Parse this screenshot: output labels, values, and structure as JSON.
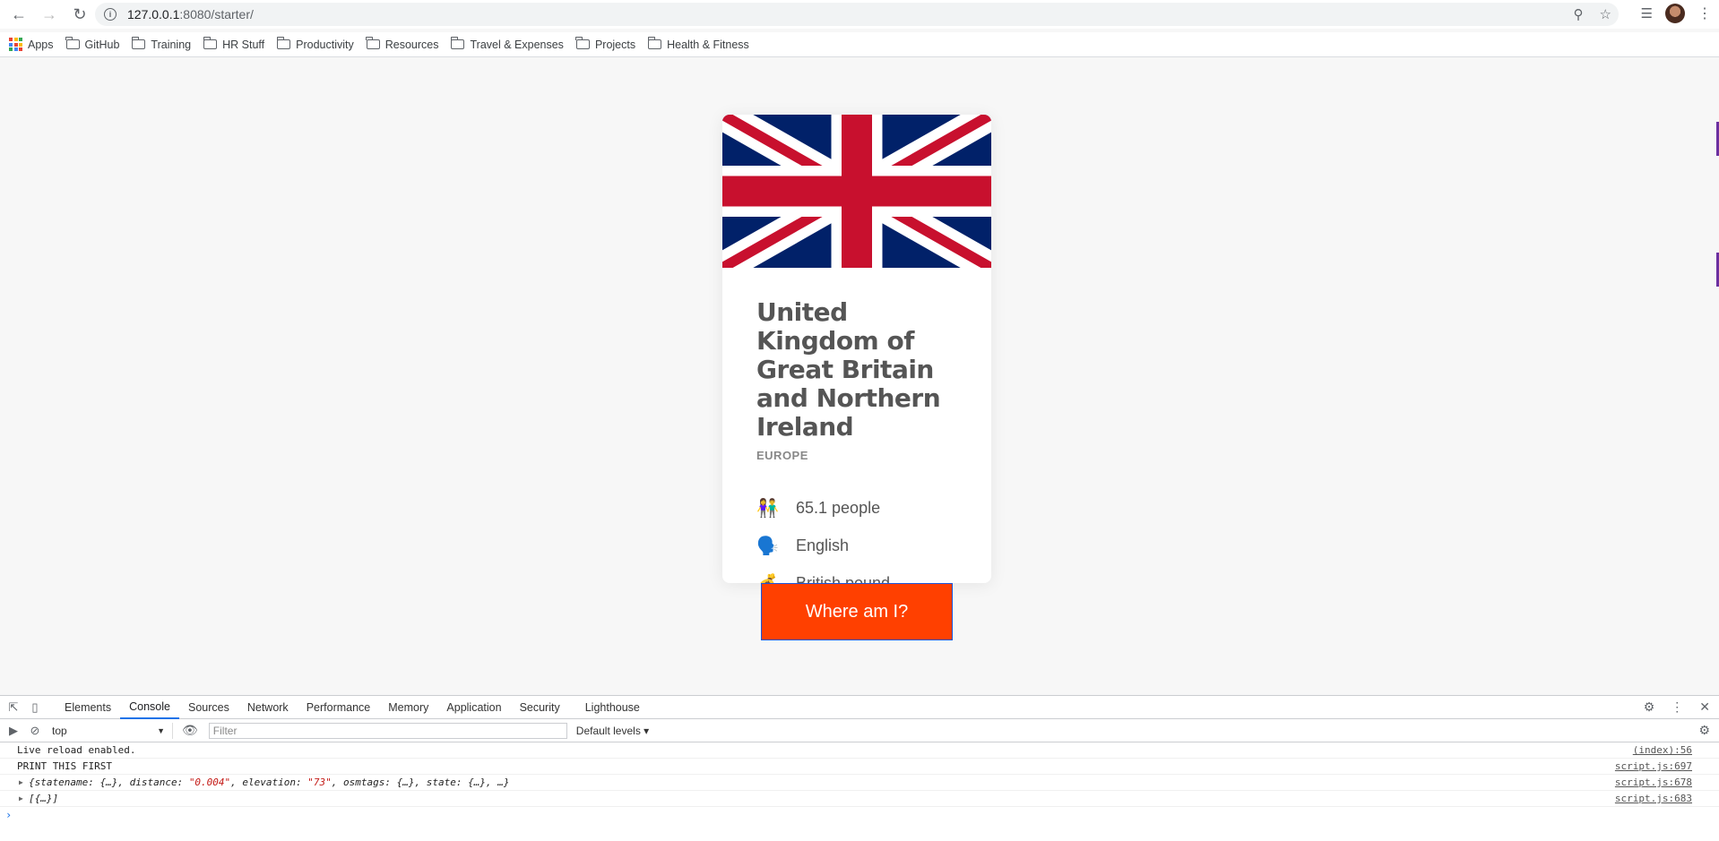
{
  "browser": {
    "url_host": "127.0.0.1",
    "url_path": ":8080/starter/",
    "bookmarks": [
      {
        "label": "Apps",
        "icon": "apps-grid-icon"
      },
      {
        "label": "GitHub",
        "icon": "folder-icon"
      },
      {
        "label": "Training",
        "icon": "folder-icon"
      },
      {
        "label": "HR Stuff",
        "icon": "folder-icon"
      },
      {
        "label": "Productivity",
        "icon": "folder-icon"
      },
      {
        "label": "Resources",
        "icon": "folder-icon"
      },
      {
        "label": "Travel & Expenses",
        "icon": "folder-icon"
      },
      {
        "label": "Projects",
        "icon": "folder-icon"
      },
      {
        "label": "Health & Fitness",
        "icon": "folder-icon"
      }
    ]
  },
  "card": {
    "flag": "united-kingdom-flag",
    "country_name": "United Kingdom of Great Britain and Northern Ireland",
    "region": "EUROPE",
    "facts": [
      {
        "icon": "👫",
        "text": "65.1 people"
      },
      {
        "icon": "🗣️",
        "text": "English"
      },
      {
        "icon": "💰",
        "text": "British pound"
      }
    ]
  },
  "button": {
    "label": "Where am I?",
    "bg_color": "#ff4000"
  },
  "devtools": {
    "tabs": [
      "Elements",
      "Console",
      "Sources",
      "Network",
      "Performance",
      "Memory",
      "Application",
      "Security",
      "Lighthouse"
    ],
    "active_tab": "Console",
    "context": "top",
    "filter_placeholder": "Filter",
    "levels": "Default levels ▾",
    "console": {
      "line1_text": "Live reload enabled.",
      "line1_src": "(index):56",
      "line2_text": "PRINT THIS FIRST",
      "line2_src": "script.js:697",
      "line3_a": "{statename: {…}, distance: ",
      "line3_dist": "\"0.004\"",
      "line3_b": ", elevation: ",
      "line3_elev": "\"73\"",
      "line3_c": ", osmtags: {…}, state: {…}, …}",
      "line3_src": "script.js:678",
      "line4_text": "[{…}]",
      "line4_src": "script.js:683"
    }
  }
}
